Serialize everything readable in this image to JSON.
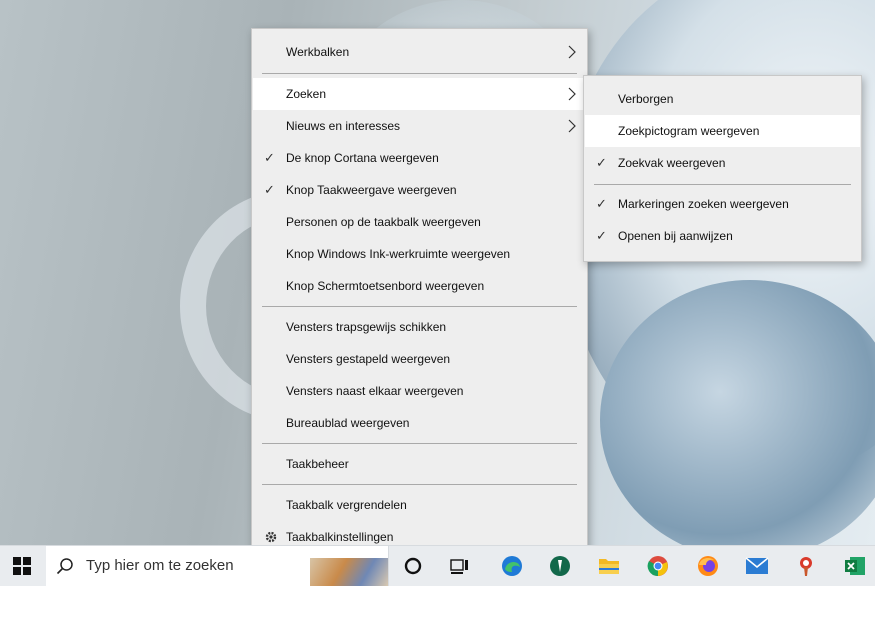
{
  "context_menu": {
    "items": [
      {
        "label": "Werkbalken",
        "checked": false,
        "submenu": true
      },
      {
        "label": "Zoeken",
        "checked": false,
        "submenu": true,
        "highlighted": true
      },
      {
        "label": "Nieuws en interesses",
        "checked": false,
        "submenu": true
      },
      {
        "label": "De knop Cortana weergeven",
        "checked": true
      },
      {
        "label": "Knop Taakweergave weergeven",
        "checked": true
      },
      {
        "label": "Personen op de taakbalk weergeven",
        "checked": false
      },
      {
        "label": "Knop Windows Ink-werkruimte weergeven",
        "checked": false
      },
      {
        "label": "Knop Schermtoetsenbord weergeven",
        "checked": false
      },
      {
        "label": "Vensters trapsgewijs schikken",
        "checked": false
      },
      {
        "label": "Vensters gestapeld weergeven",
        "checked": false
      },
      {
        "label": "Vensters naast elkaar weergeven",
        "checked": false
      },
      {
        "label": "Bureaublad weergeven",
        "checked": false
      },
      {
        "label": "Taakbeheer",
        "checked": false
      },
      {
        "label": "Taakbalk vergrendelen",
        "checked": false
      },
      {
        "label": "Taakbalkinstellingen",
        "icon": "gear-icon"
      }
    ]
  },
  "submenu_zoeken": {
    "items": [
      {
        "label": "Verborgen",
        "checked": false
      },
      {
        "label": "Zoekpictogram weergeven",
        "checked": false,
        "highlighted": true
      },
      {
        "label": "Zoekvak weergeven",
        "checked": true
      },
      {
        "label": "Markeringen zoeken weergeven",
        "checked": true
      },
      {
        "label": "Openen bij aanwijzen",
        "checked": true
      }
    ]
  },
  "taskbar": {
    "search_placeholder": "Typ hier om te zoeken",
    "icons": [
      "windows-start-icon",
      "search-icon",
      "cortana-icon",
      "task-view-icon",
      "edge-icon",
      "app-icon",
      "file-explorer-icon",
      "chrome-icon",
      "firefox-icon",
      "mail-icon",
      "paint-icon",
      "excel-icon"
    ]
  },
  "colors": {
    "menu_bg": "#eeeeee",
    "highlight": "#ffffff",
    "taskbar_bg": "#e9ecef"
  }
}
